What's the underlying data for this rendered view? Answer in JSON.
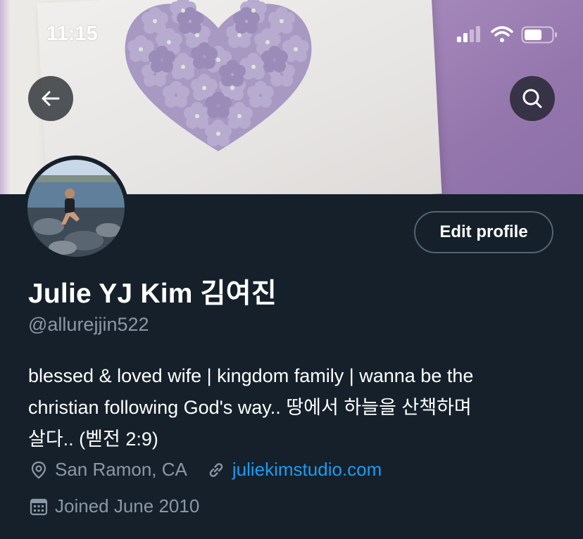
{
  "status_bar": {
    "time": "11:15"
  },
  "profile": {
    "display_name": "Julie YJ Kim 김여진",
    "handle": "@allurejjin522",
    "bio_lines": [
      "blessed & loved wife | kingdom family | wanna be the",
      "christian following God's way.. 땅에서 하늘을 산책하며",
      "살다.. (벧전 2:9)"
    ],
    "location": "San Ramon, CA",
    "website": "juliekimstudio.com",
    "joined": "Joined June 2010"
  },
  "actions": {
    "edit_profile_label": "Edit profile"
  },
  "icons": {
    "back": "arrow-left-icon",
    "search": "search-icon",
    "location": "location-pin-icon",
    "link": "link-icon",
    "calendar": "calendar-icon",
    "signal": "signal-icon",
    "wifi": "wifi-icon",
    "battery": "battery-icon"
  },
  "colors": {
    "background": "#15202b",
    "secondary_text": "#8b98a5",
    "link": "#1d9bf0",
    "button_border": "#536471"
  }
}
